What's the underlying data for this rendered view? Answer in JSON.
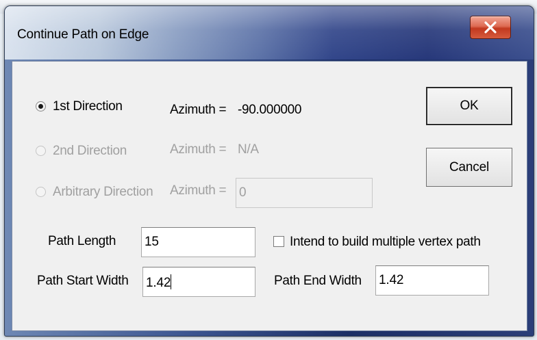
{
  "window": {
    "title": "Continue Path on Edge",
    "close_label": "X"
  },
  "directions": [
    {
      "label": "1st Direction",
      "selected": true,
      "enabled": true,
      "azimuth_label": "Azimuth =",
      "azimuth_value": "-90.000000"
    },
    {
      "label": "2nd Direction",
      "selected": false,
      "enabled": false,
      "azimuth_label": "Azimuth =",
      "azimuth_value": "N/A"
    },
    {
      "label": "Arbitrary Direction",
      "selected": false,
      "enabled": false,
      "azimuth_label": "Azimuth =",
      "azimuth_value": "0"
    }
  ],
  "buttons": {
    "ok": "OK",
    "cancel": "Cancel"
  },
  "path": {
    "length_label": "Path Length",
    "length_value": "15",
    "start_width_label": "Path Start Width",
    "start_width_value": "1.42",
    "end_width_label": "Path End Width",
    "end_width_value": "1.42",
    "multi_vertex_label": "Intend to build multiple vertex path",
    "multi_vertex_checked": false
  },
  "colors": {
    "disabled_text": "#a0a0a0",
    "close_button": "#c2391f",
    "title_bar_dark": "#27387a"
  }
}
